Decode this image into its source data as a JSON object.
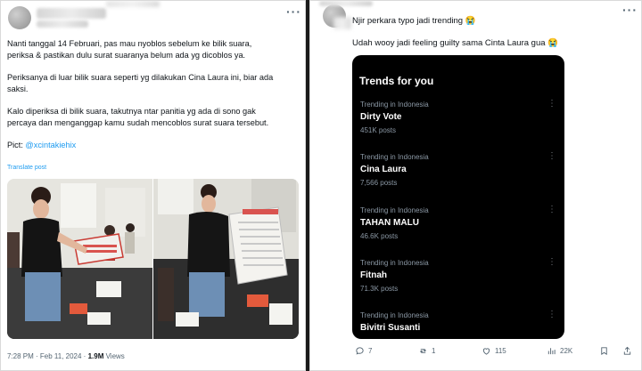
{
  "left_tweet": {
    "paragraphs": [
      [
        "Nanti tanggal 14 Februari, pas mau nyoblos sebelum ke bilik suara,",
        "periksa & pastikan dulu surat suaranya belum ada yg dicoblos ya."
      ],
      [
        "Periksanya di luar bilik suara seperti yg dilakukan Cina Laura ini, biar ada",
        "saksi."
      ],
      [
        "Kalo diperiksa di bilik suara, takutnya ntar panitia yg ada di sono gak",
        "percaya dan menganggap kamu sudah mencoblos surat suara tersebut."
      ]
    ],
    "pic_label": "Pict: ",
    "pic_handle": "@xcintakiehix",
    "translate": "Translate post",
    "time": "7:28 PM · Feb 11, 2024 · ",
    "views_count": "1.9M",
    "views_label": " Views"
  },
  "right_tweet": {
    "line1": "Njir perkara typo jadi trending 😭",
    "line2": "Udah wooy jadi feeling guilty sama Cinta Laura gua 😭",
    "trends_header": "Trends for you",
    "trends": [
      {
        "context": "Trending in Indonesia",
        "name": "Dirty Vote",
        "posts": "451K posts"
      },
      {
        "context": "Trending in Indonesia",
        "name": "Cina Laura",
        "posts": "7,566 posts"
      },
      {
        "context": "Trending in Indonesia",
        "name": "TAHAN MALU",
        "posts": "46.6K posts"
      },
      {
        "context": "Trending in Indonesia",
        "name": "Fitnah",
        "posts": "71.3K posts"
      },
      {
        "context": "Trending in Indonesia",
        "name": "Bivitri Susanti",
        "posts": ""
      }
    ],
    "actions": {
      "replies": "7",
      "retweets": "1",
      "likes": "115",
      "views": "22K"
    }
  },
  "colors": {
    "link": "#1d9bf0",
    "text": "#0f1419",
    "muted": "#536471",
    "trends_bg": "#000000"
  },
  "icons": [
    "more-icon",
    "reply-icon",
    "retweet-icon",
    "like-icon",
    "views-icon",
    "bookmark-icon",
    "share-icon"
  ]
}
